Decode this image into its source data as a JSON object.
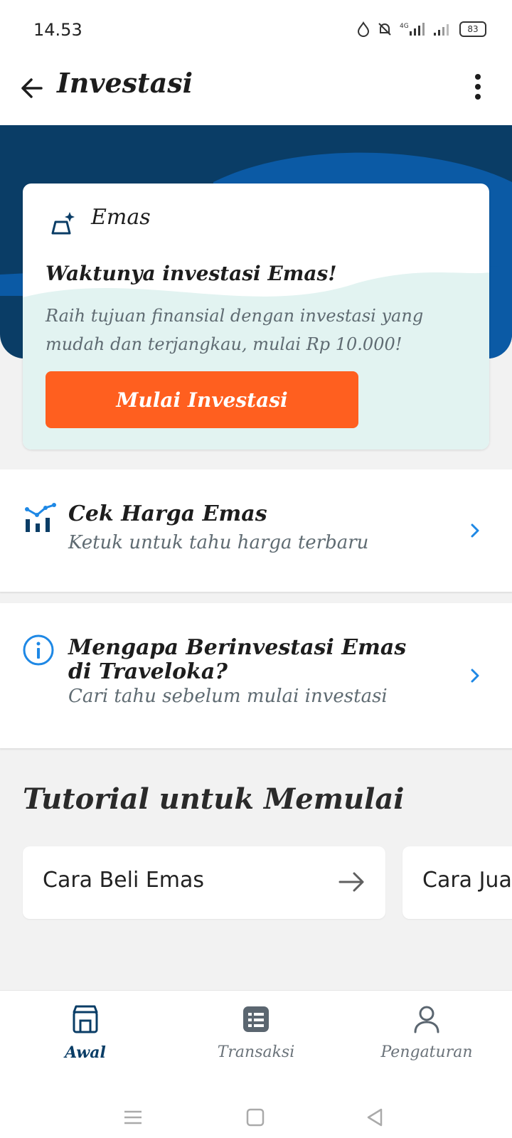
{
  "status_bar": {
    "time": "14.53",
    "battery": "83"
  },
  "app_bar": {
    "title": "Investasi"
  },
  "hero_card": {
    "label": "Emas",
    "headline": "Waktunya investasi Emas!",
    "description": "Raih tujuan finansial dengan investasi yang mudah dan terjangkau, mulai Rp 10.000!",
    "cta_label": "Mulai Investasi"
  },
  "rows": [
    {
      "title": "Cek Harga Emas",
      "subtitle": "Ketuk untuk tahu harga terbaru"
    },
    {
      "title": "Mengapa Berinvestasi Emas di Traveloka?",
      "subtitle": "Cari tahu sebelum mulai investasi"
    }
  ],
  "tutorial": {
    "title": "Tutorial untuk Memulai",
    "items": [
      {
        "label": "Cara Beli Emas"
      },
      {
        "label": "Cara Jual"
      }
    ]
  },
  "bottom_nav": {
    "items": [
      {
        "label": "Awal"
      },
      {
        "label": "Transaksi"
      },
      {
        "label": "Pengaturan"
      }
    ]
  },
  "colors": {
    "primary_dark": "#0a3d66",
    "accent": "#ff5f1f",
    "link_blue": "#1e88e5"
  }
}
